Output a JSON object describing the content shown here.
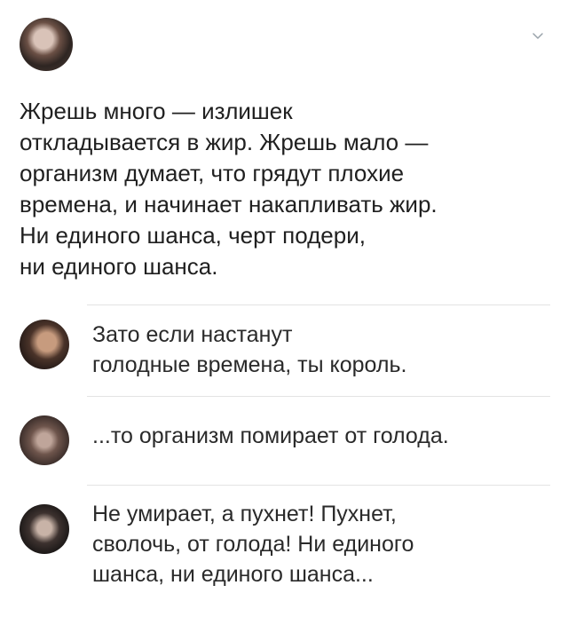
{
  "author": {
    "name": "",
    "handle": ""
  },
  "tweet": {
    "text": "Жрешь много — излишек\nоткладывается в жир. Жрешь мало —\nорганизм думает, что грядут плохие\nвремена, и начинает накапливать жир.\nНи единого шанса, черт подери,\nни единого шанса."
  },
  "replies": [
    {
      "text": "Зато если настанут\nголодные времена, ты король."
    },
    {
      "text": "...то организм помирает от голода."
    },
    {
      "text": "Не умирает, а пухнет! Пухнет,\nсволочь, от голода! Ни единого\nшанса, ни единого шанса..."
    }
  ],
  "icons": {
    "menu": "chevron-down-icon"
  }
}
